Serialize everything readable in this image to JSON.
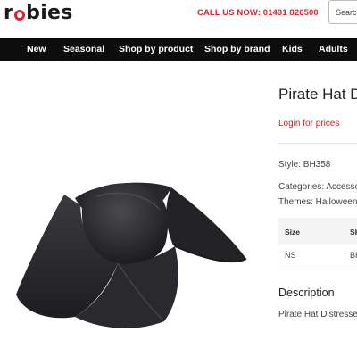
{
  "brand": {
    "logo_text_r": "r",
    "logo_text_rest": "bies",
    "brand_color": "#d8262d"
  },
  "header": {
    "call_label": "CALL US NOW: 01491 826500",
    "search_placeholder": "Search"
  },
  "nav": {
    "items": [
      {
        "label": "New"
      },
      {
        "label": "Seasonal"
      },
      {
        "label": "Shop by product"
      },
      {
        "label": "Shop by brand"
      },
      {
        "label": "Kids"
      },
      {
        "label": "Adults"
      }
    ]
  },
  "product": {
    "image_icon": "pirate-hat-image",
    "title": "Pirate Hat D",
    "login_label": "Login for prices",
    "style": "Style: BH358",
    "categories": "Categories: Accesso",
    "themes": "Themes: Halloween,",
    "table": {
      "headers": [
        "Size",
        "SK"
      ],
      "rows": [
        [
          "NS",
          "BH"
        ]
      ]
    },
    "description_title": "Description",
    "description_text": "Pirate Hat Distresse"
  }
}
